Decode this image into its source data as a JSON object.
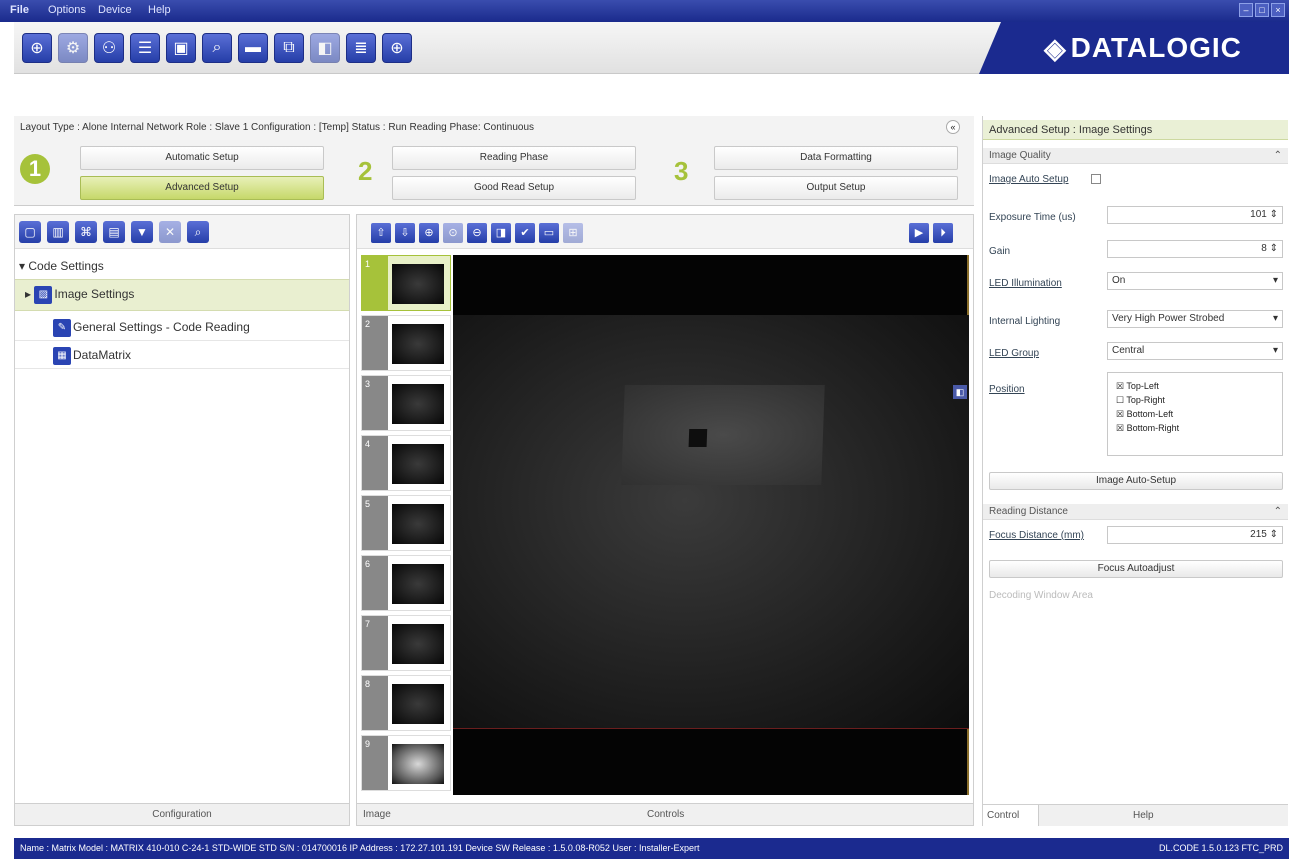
{
  "menu": {
    "items": [
      "File",
      "Options",
      "Device",
      "Help"
    ]
  },
  "brand": {
    "logo": "DATALOGIC"
  },
  "toolbar_icons": [
    "home-icon",
    "settings-icon",
    "user-icon",
    "document-icon",
    "monitor-icon",
    "search-icon",
    "window-icon",
    "network-icon",
    "camera-icon",
    "list-icon",
    "target-icon"
  ],
  "status_line": "Layout Type : Alone  Internal Network Role : Slave 1  Configuration : [Temp]  Status :  Run  Reading Phase: Continuous",
  "wizard": {
    "step1": "1",
    "step2": "2",
    "step3": "3",
    "automatic_setup": "Automatic Setup",
    "advanced_setup": "Advanced Setup",
    "reading_phase": "Reading Phase",
    "good_read_setup": "Good Read Setup",
    "data_formatting": "Data Formatting",
    "output_setup": "Output Setup"
  },
  "tree": {
    "root": "Code Settings",
    "items": [
      "Image Settings",
      "General Settings - Code Reading",
      "DataMatrix"
    ]
  },
  "left_tab": "Configuration",
  "center_tabs": {
    "left": "Image",
    "right": "Controls"
  },
  "thumbnails": [
    "1",
    "2",
    "3",
    "4",
    "5",
    "6",
    "7",
    "8",
    "9"
  ],
  "right_panel": {
    "header": "Advanced Setup : Image Settings",
    "image_quality": "Image Quality",
    "image_auto_setup_label": "Image Auto Setup",
    "exposure_label": "Exposure Time (us)",
    "exposure_value": "101",
    "gain_label": "Gain",
    "gain_value": "8",
    "led_ill_label": "LED Illumination",
    "led_ill_value": "On",
    "internal_lighting_label": "Internal Lighting",
    "internal_lighting_value": "Very High Power Strobed",
    "led_group_label": "LED Group",
    "led_group_value": "Central",
    "position_label": "Position",
    "positions": [
      "Top-Left",
      "Top-Right",
      "Bottom-Left",
      "Bottom-Right"
    ],
    "image_auto_setup_btn": "Image Auto-Setup",
    "reading_distance": "Reading Distance",
    "focus_label": "Focus Distance (mm)",
    "focus_value": "215",
    "focus_autoadjust_btn": "Focus Autoadjust",
    "collapsed_section": "Decoding Window Area",
    "tab_control": "Control",
    "tab_help": "Help"
  },
  "footer": {
    "left": "Name : Matrix  Model : MATRIX 410-010 C-24-1 STD-WIDE STD  S/N : 014700016  IP Address : 172.27.101.191  Device SW Release : 1.5.0.08-R052  User : Installer-Expert",
    "right": "DL.CODE 1.5.0.123 FTC_PRD"
  }
}
